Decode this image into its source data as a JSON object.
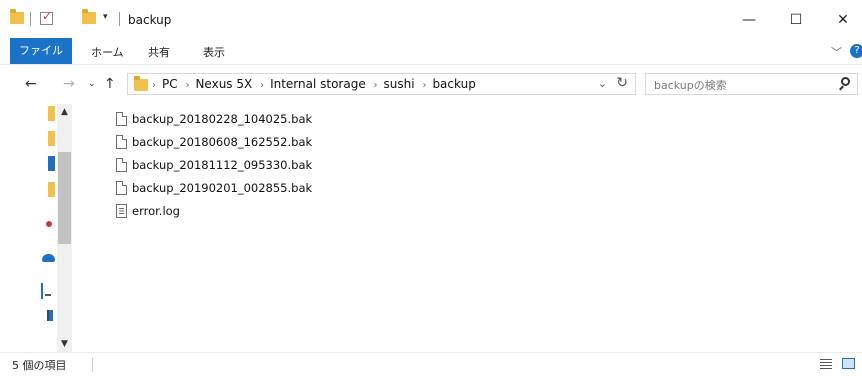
{
  "window": {
    "title": "backup",
    "controls": {
      "minimize": "—",
      "maximize": "☐",
      "close": "✕"
    }
  },
  "ribbon": {
    "tabs": [
      "ファイル",
      "ホーム",
      "共有",
      "表示"
    ],
    "collapse_icon": "chevron-down",
    "help_glyph": "?"
  },
  "address": {
    "breadcrumbs": [
      "PC",
      "Nexus 5X",
      "Internal storage",
      "sushi",
      "backup"
    ],
    "separator": "›"
  },
  "search": {
    "placeholder": "backupの検索"
  },
  "files": [
    {
      "name": "backup_20180228_104025.bak",
      "icon": "file-icon"
    },
    {
      "name": "backup_20180608_162552.bak",
      "icon": "file-icon"
    },
    {
      "name": "backup_20181112_095330.bak",
      "icon": "file-icon"
    },
    {
      "name": "backup_20190201_002855.bak",
      "icon": "file-icon"
    },
    {
      "name": "error.log",
      "icon": "text-file-icon"
    }
  ],
  "status": {
    "item_count": "5 個の項目"
  },
  "colors": {
    "accent": "#1a73c7",
    "folder": "#f2c14b"
  }
}
